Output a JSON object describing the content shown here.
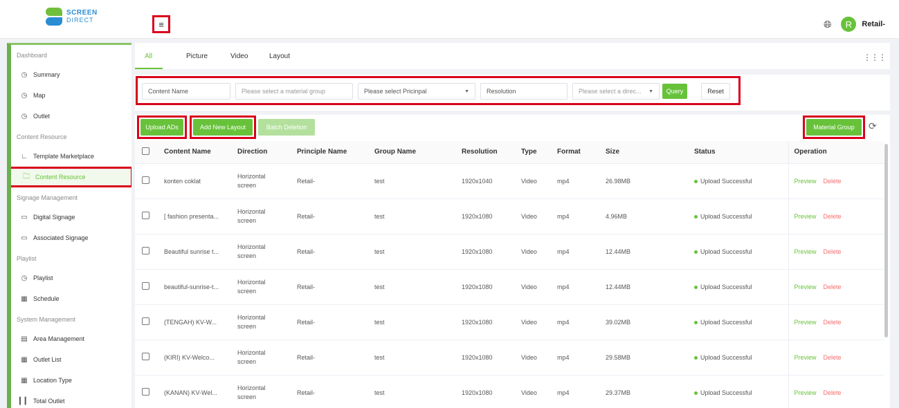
{
  "header": {
    "logo_line1": "SCREEN",
    "logo_line2": "DIRECT",
    "menu_icon": "menu-fold-icon",
    "language_icon": "globe-icon",
    "avatar_letter": "R",
    "user_name": "Retail-"
  },
  "sidebar": {
    "sections": [
      {
        "title": "Dashboard",
        "items": [
          {
            "label": "Summary",
            "icon": "clock-icon"
          },
          {
            "label": "Map",
            "icon": "clock-icon"
          },
          {
            "label": "Outlet",
            "icon": "clock-icon"
          }
        ]
      },
      {
        "title": "Content Resource",
        "items": [
          {
            "label": "Template Marketplace",
            "icon": "chart-icon"
          },
          {
            "label": "Content Resource",
            "icon": "folder-icon",
            "active": true
          }
        ]
      },
      {
        "title": "Signage Management",
        "items": [
          {
            "label": "Digital Signage",
            "icon": "monitor-icon"
          },
          {
            "label": "Associated Signage",
            "icon": "monitor-icon"
          }
        ]
      },
      {
        "title": "Playlist",
        "items": [
          {
            "label": "Playlist",
            "icon": "clock-icon"
          },
          {
            "label": "Schedule",
            "icon": "calendar-icon"
          }
        ]
      },
      {
        "title": "System Management",
        "items": [
          {
            "label": "Area Management",
            "icon": "list-icon"
          },
          {
            "label": "Outlet List",
            "icon": "table-icon"
          },
          {
            "label": "Location Type",
            "icon": "table-icon"
          },
          {
            "label": "Total Outlet",
            "icon": "bar-icon"
          }
        ]
      }
    ]
  },
  "tabs": [
    {
      "label": "All",
      "active": true
    },
    {
      "label": "Picture"
    },
    {
      "label": "Video"
    },
    {
      "label": "Layout"
    }
  ],
  "filters": {
    "content_name": "Content Name",
    "material_group": "Please select a material group",
    "principal": "Please select Pricinpal",
    "resolution": "Resolution",
    "direction": "Please select a direc...",
    "query_label": "Query",
    "reset_label": "Reset"
  },
  "actions": {
    "upload_label": "Upload ADs",
    "add_layout_label": "Add New Layout",
    "batch_delete_label": "Batch Deletion",
    "material_group_label": "Material Group"
  },
  "table": {
    "headers": [
      "Content Name",
      "Direction",
      "Principle Name",
      "Group Name",
      "Resolution",
      "Type",
      "Format",
      "Size",
      "Status",
      "Operation"
    ],
    "preview_label": "Preview",
    "delete_label": "Delete",
    "rows": [
      {
        "name": "konten coklat",
        "dir1": "Horizontal",
        "dir2": "screen",
        "principal": "Retail-",
        "group": "test",
        "resolution": "1920x1040",
        "type": "Video",
        "format": "mp4",
        "size": "26.98MB",
        "status": "Upload Successful"
      },
      {
        "name": "[ fashion presenta...",
        "dir1": "Horizontal",
        "dir2": "screen",
        "principal": "Retail-",
        "group": "test",
        "resolution": "1920x1080",
        "type": "Video",
        "format": "mp4",
        "size": "4.96MB",
        "status": "Upload Successful"
      },
      {
        "name": "Beautiful sunrise t...",
        "dir1": "Horizontal",
        "dir2": "screen",
        "principal": "Retail-",
        "group": "test",
        "resolution": "1920x1080",
        "type": "Video",
        "format": "mp4",
        "size": "12.44MB",
        "status": "Upload Successful"
      },
      {
        "name": "beautiful-sunrise-t...",
        "dir1": "Horizontal",
        "dir2": "screen",
        "principal": "Retail-",
        "group": "test",
        "resolution": "1920x1080",
        "type": "Video",
        "format": "mp4",
        "size": "12.44MB",
        "status": "Upload Successful"
      },
      {
        "name": "(TENGAH) KV-W...",
        "dir1": "Horizontal",
        "dir2": "screen",
        "principal": "Retail-",
        "group": "test",
        "resolution": "1920x1080",
        "type": "Video",
        "format": "mp4",
        "size": "39.02MB",
        "status": "Upload Successful"
      },
      {
        "name": "(KIRI) KV-Welco...",
        "dir1": "Horizontal",
        "dir2": "screen",
        "principal": "Retail-",
        "group": "test",
        "resolution": "1920x1080",
        "type": "Video",
        "format": "mp4",
        "size": "29.58MB",
        "status": "Upload Successful"
      },
      {
        "name": "(KANAN) KV-Wel...",
        "dir1": "Horizontal",
        "dir2": "screen",
        "principal": "Retail-",
        "group": "test",
        "resolution": "1920x1080",
        "type": "Video",
        "format": "mp4",
        "size": "29.37MB",
        "status": "Upload Successful"
      }
    ]
  },
  "colors": {
    "accent": "#67c23a",
    "danger": "#f56c6c",
    "highlight": "#d9001b"
  }
}
